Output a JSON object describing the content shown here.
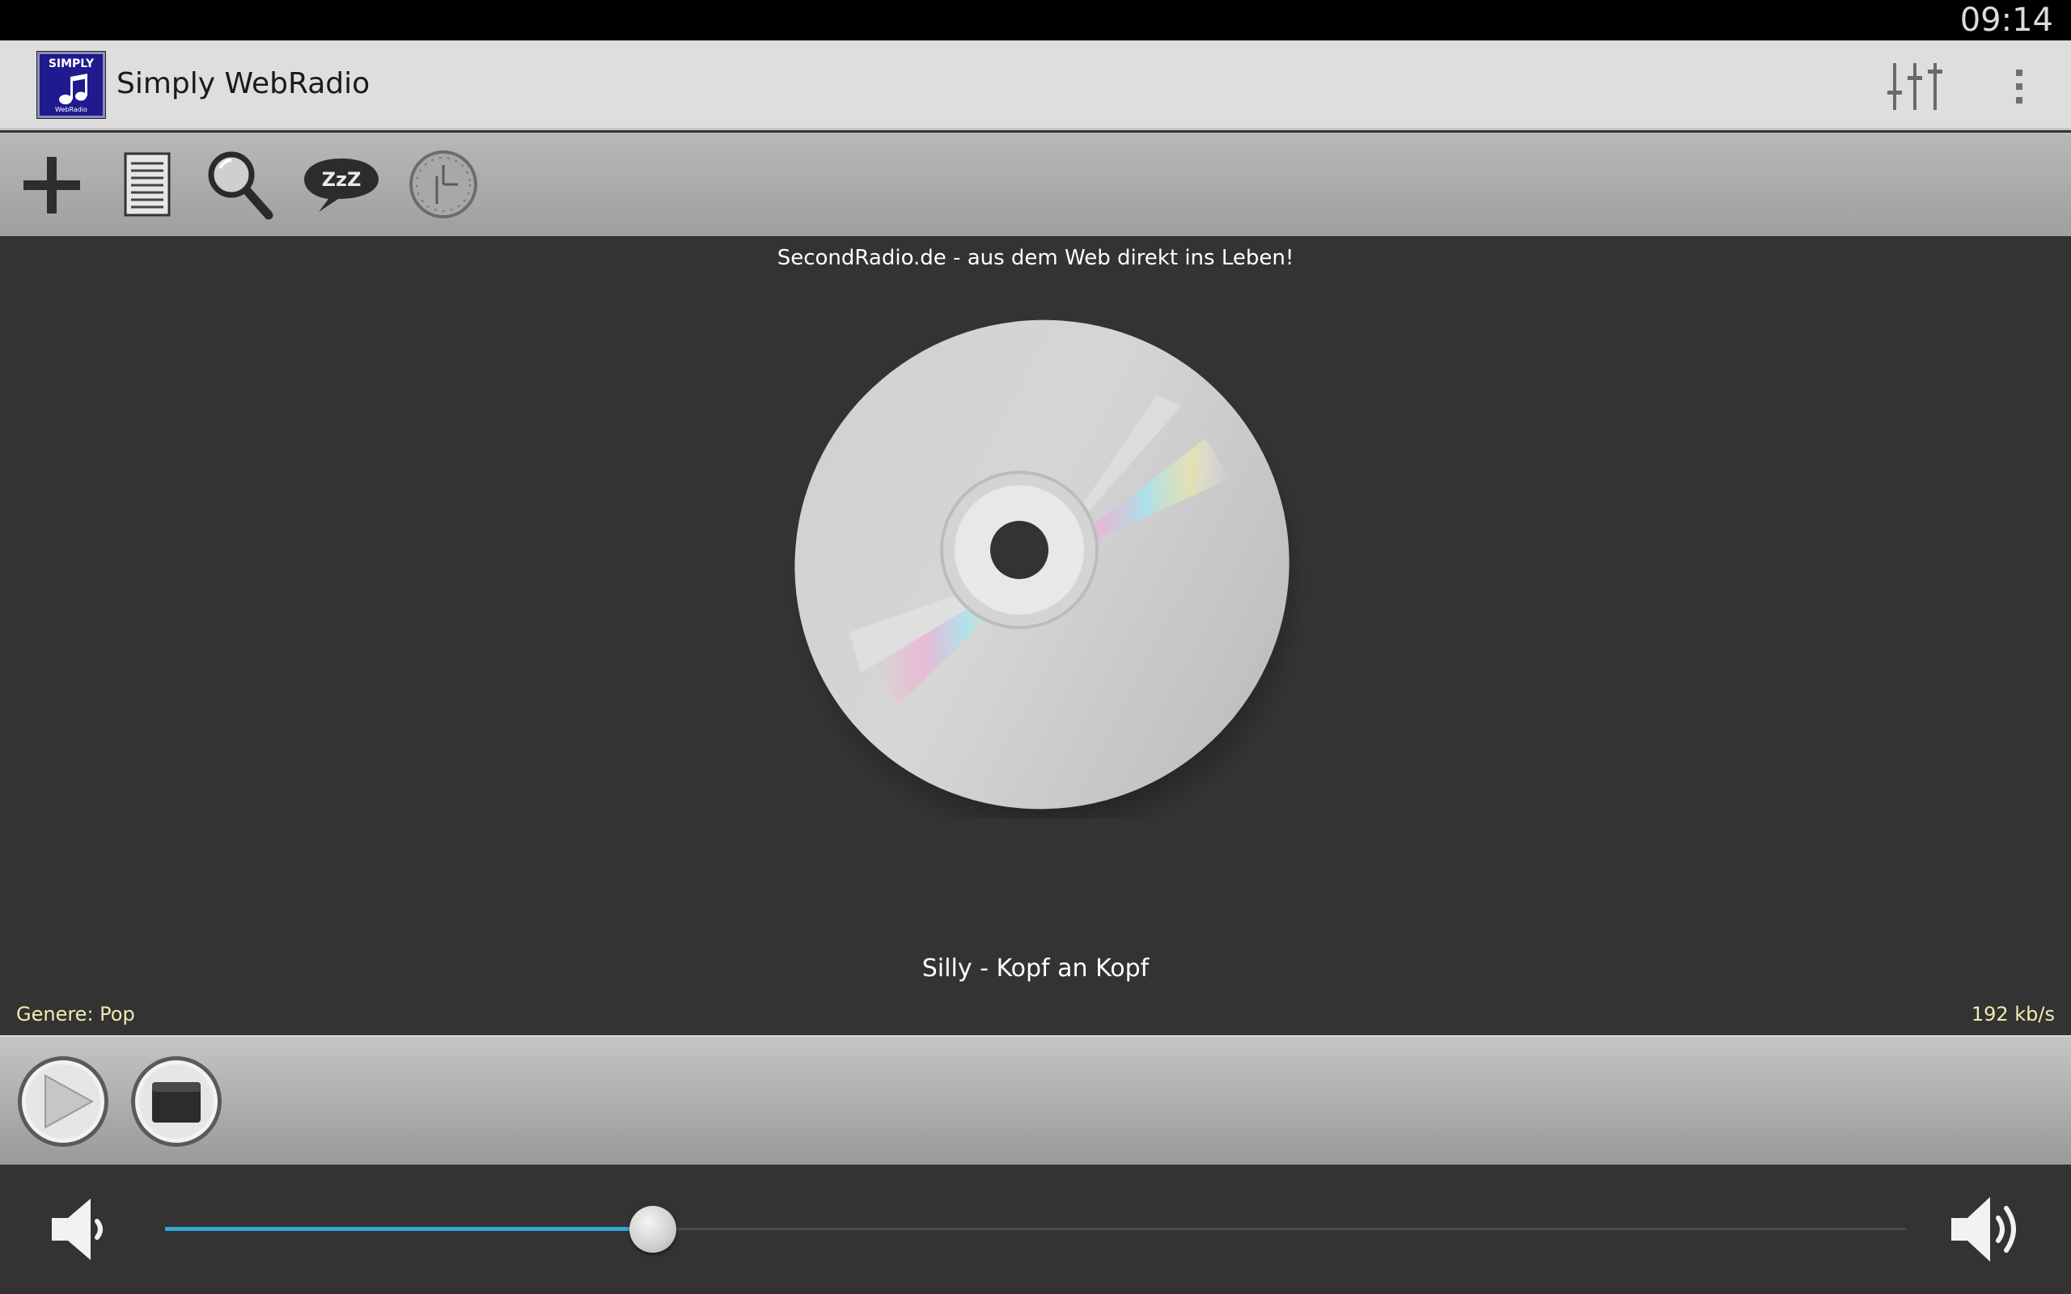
{
  "status_bar": {
    "time": "09:14"
  },
  "action_bar": {
    "logo": {
      "top_text": "SIMPLY",
      "bottom_text": "WebRadio"
    },
    "title": "Simply WebRadio",
    "icons": {
      "equalizer": "equalizer-icon",
      "overflow": "overflow-menu-icon"
    }
  },
  "toolbar": {
    "icons": [
      "add-icon",
      "list-icon",
      "search-icon",
      "sleep-icon",
      "alarm-clock-icon"
    ],
    "sleep_label": "ZzZ"
  },
  "player": {
    "station": "SecondRadio.de - aus dem Web direkt ins Leben!",
    "track": "Silly - Kopf an Kopf",
    "genre": "Genere: Pop",
    "bitrate": "192 kb/s"
  },
  "controls": {
    "icons": [
      "play-icon",
      "stop-icon"
    ]
  },
  "volume": {
    "level": 0.28,
    "accent_color": "#35a8d9"
  }
}
